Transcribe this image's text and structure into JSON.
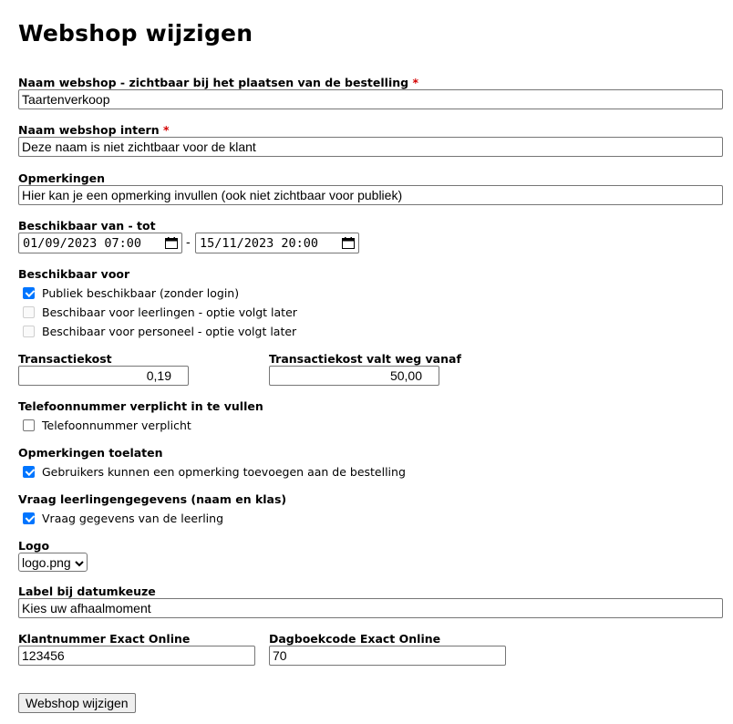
{
  "page_title": "Webshop wijzigen",
  "required_mark": "*",
  "fields": {
    "name_public": {
      "label": "Naam webshop - zichtbaar bij het plaatsen van de bestelling",
      "value": "Taartenverkoop"
    },
    "name_internal": {
      "label": "Naam webshop intern",
      "value": "Deze naam is niet zichtbaar voor de klant"
    },
    "remarks": {
      "label": "Opmerkingen",
      "value": "Hier kan je een opmerking invullen (ook niet zichtbaar voor publiek)"
    },
    "availability": {
      "label": "Beschikbaar van - tot",
      "from": "01/09/2023 07:00",
      "separator": "-",
      "to": "15/11/2023 20:00"
    },
    "available_for": {
      "label": "Beschikbaar voor",
      "options": [
        {
          "label": "Publiek beschikbaar (zonder login)",
          "checked": true,
          "disabled": false
        },
        {
          "label": "Beschibaar voor leerlingen - optie volgt later",
          "checked": false,
          "disabled": true
        },
        {
          "label": "Beschibaar voor personeel - optie volgt later",
          "checked": false,
          "disabled": true
        }
      ]
    },
    "transaction_cost": {
      "label": "Transactiekost",
      "value": "0,19"
    },
    "transaction_cost_free_from": {
      "label": "Transactiekost valt weg vanaf",
      "value": "50,00"
    },
    "phone_required": {
      "label": "Telefoonnummer verplicht in te vullen",
      "option": "Telefoonnummer verplicht",
      "checked": false
    },
    "allow_remarks": {
      "label": "Opmerkingen toelaten",
      "option": "Gebruikers kunnen een opmerking toevoegen aan de bestelling",
      "checked": true
    },
    "student_info": {
      "label": "Vraag leerlingengegevens (naam en klas)",
      "option": "Vraag gegevens van de leerling",
      "checked": true
    },
    "logo": {
      "label": "Logo",
      "selected": "logo.png"
    },
    "date_label": {
      "label": "Label bij datumkeuze",
      "value": "Kies uw afhaalmoment"
    },
    "exact_customer": {
      "label": "Klantnummer Exact Online",
      "value": "123456"
    },
    "exact_journal": {
      "label": "Dagboekcode Exact Online",
      "value": "70"
    }
  },
  "submit_label": "Webshop wijzigen",
  "colors": {
    "checkbox_checked": "#0075ff",
    "required": "#d40000",
    "border": "#767676"
  }
}
